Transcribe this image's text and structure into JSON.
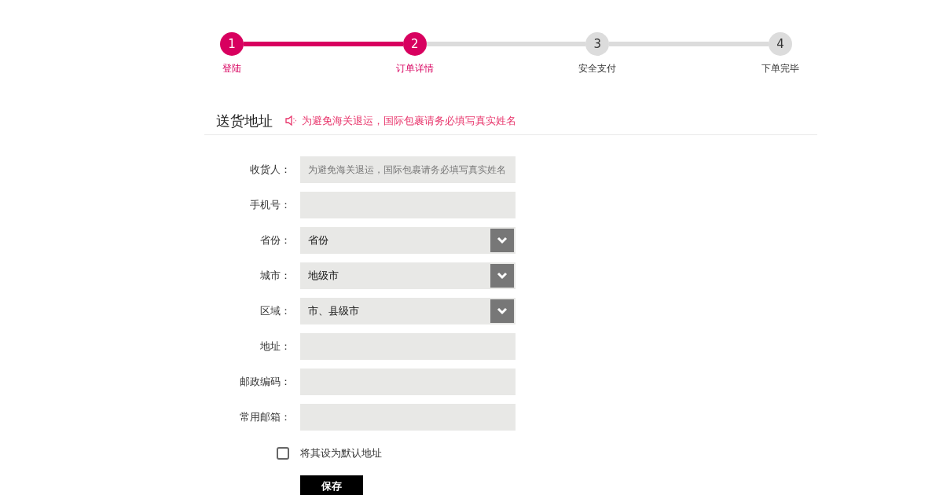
{
  "steps": [
    {
      "number": "1",
      "label": "登陆",
      "done": true
    },
    {
      "number": "2",
      "label": "订单详情",
      "done": true
    },
    {
      "number": "3",
      "label": "安全支付",
      "done": false
    },
    {
      "number": "4",
      "label": "下单完毕",
      "done": false
    }
  ],
  "section": {
    "title": "送货地址",
    "notice": "为避免海关退运，国际包裹请务必填写真实姓名"
  },
  "fields": [
    {
      "label": "收货人：",
      "kind": "text",
      "placeholder": "为避免海关退运，国际包裹请务必填写真实姓名"
    },
    {
      "label": "手机号：",
      "kind": "text"
    },
    {
      "label": "省份：",
      "kind": "select",
      "value": "省份"
    },
    {
      "label": "城市：",
      "kind": "select",
      "value": "地级市"
    },
    {
      "label": "区域：",
      "kind": "select",
      "value": "市、县级市"
    },
    {
      "label": "地址：",
      "kind": "text"
    },
    {
      "label": "邮政编码：",
      "kind": "text"
    },
    {
      "label": "常用邮箱：",
      "kind": "text"
    }
  ],
  "default_address": {
    "label": "将其设为默认地址",
    "checked": false
  },
  "save_button": "保存"
}
